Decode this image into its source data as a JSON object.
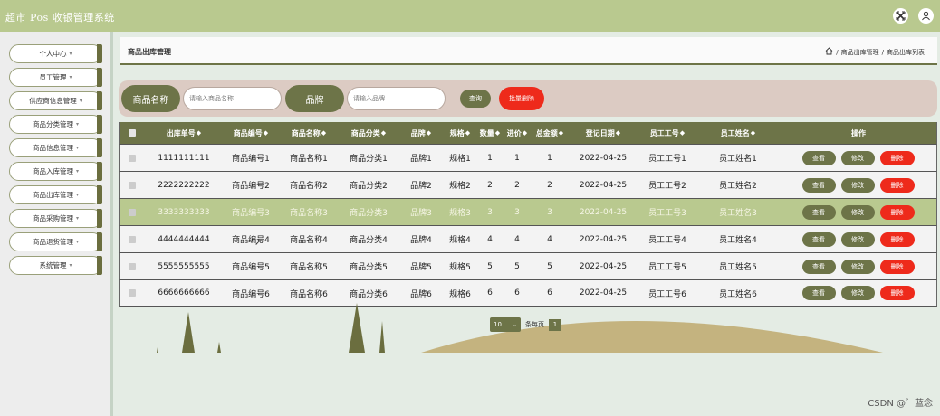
{
  "app": {
    "title": "超市 Pos 收银管理系统"
  },
  "sidebar": {
    "items": [
      {
        "label": "个人中心"
      },
      {
        "label": "员工管理"
      },
      {
        "label": "供应商信息管理"
      },
      {
        "label": "商品分类管理"
      },
      {
        "label": "商品信息管理"
      },
      {
        "label": "商品入库管理"
      },
      {
        "label": "商品出库管理"
      },
      {
        "label": "商品采购管理"
      },
      {
        "label": "商品退货管理"
      },
      {
        "label": "系统管理"
      }
    ]
  },
  "page": {
    "title": "商品出库管理",
    "breadcrumb": [
      "商品出库管理",
      "商品出库列表"
    ],
    "breadcrumb_sep": "/"
  },
  "search": {
    "name_label": "商品名称",
    "name_placeholder": "请输入商品名称",
    "brand_label": "品牌",
    "brand_placeholder": "请输入品牌",
    "query_label": "查询",
    "bulk_delete_label": "批量删除"
  },
  "table": {
    "columns": [
      "出库单号",
      "商品编号",
      "商品名称",
      "商品分类",
      "品牌",
      "规格",
      "数量",
      "进价",
      "总金额",
      "登记日期",
      "员工工号",
      "员工姓名",
      "操作"
    ],
    "rows": [
      [
        "1111111111",
        "商品编号1",
        "商品名称1",
        "商品分类1",
        "品牌1",
        "规格1",
        "1",
        "1",
        "1",
        "2022-04-25",
        "员工工号1",
        "员工姓名1"
      ],
      [
        "2222222222",
        "商品编号2",
        "商品名称2",
        "商品分类2",
        "品牌2",
        "规格2",
        "2",
        "2",
        "2",
        "2022-04-25",
        "员工工号2",
        "员工姓名2"
      ],
      [
        "3333333333",
        "商品编号3",
        "商品名称3",
        "商品分类3",
        "品牌3",
        "规格3",
        "3",
        "3",
        "3",
        "2022-04-25",
        "员工工号3",
        "员工姓名3"
      ],
      [
        "4444444444",
        "商品编号4",
        "商品名称4",
        "商品分类4",
        "品牌4",
        "规格4",
        "4",
        "4",
        "4",
        "2022-04-25",
        "员工工号4",
        "员工姓名4"
      ],
      [
        "5555555555",
        "商品编号5",
        "商品名称5",
        "商品分类5",
        "品牌5",
        "规格5",
        "5",
        "5",
        "5",
        "2022-04-25",
        "员工工号5",
        "员工姓名5"
      ],
      [
        "6666666666",
        "商品编号6",
        "商品名称6",
        "商品分类6",
        "品牌6",
        "规格6",
        "6",
        "6",
        "6",
        "2022-04-25",
        "员工工号6",
        "员工姓名6"
      ]
    ],
    "highlighted_row": 2,
    "actions": {
      "view": "查看",
      "edit": "修改",
      "delete": "删除"
    },
    "sort_glyph": "◆"
  },
  "pagination": {
    "page_size": "10",
    "per_page_label": "条每页",
    "current_page": "1"
  },
  "watermark": "CSDN @゛蓝念",
  "colors": {
    "header": "#b9c98f",
    "accent": "#6d7448",
    "danger": "#ee2a1b"
  }
}
